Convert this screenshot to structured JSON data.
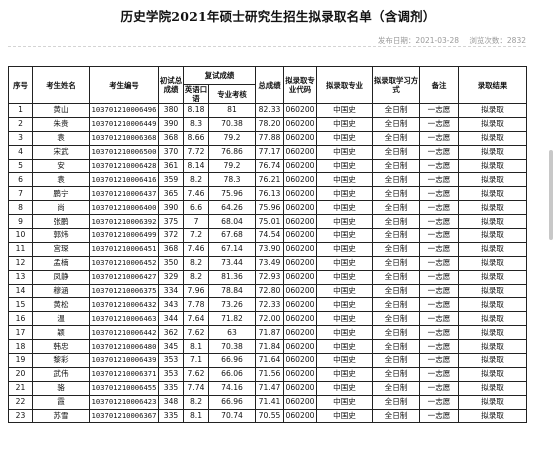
{
  "document": {
    "title": "历史学院2021年硕士研究生招生拟录取名单（含调剂）",
    "publish_label": "发布日期：2021-03-28",
    "views_label": "浏览次数：2832"
  },
  "table": {
    "headers": {
      "seq": "序号",
      "name": "考生姓名",
      "exam_no": "考生编号",
      "initial_score": "初试总成绩",
      "retest_group": "复试成绩",
      "english_oral": "英语口语",
      "major_exam": "专业考核",
      "total": "总成绩",
      "major_code": "拟录取专业代码",
      "major": "拟录取专业",
      "study_mode": "拟录取学习方式",
      "remark": "备注",
      "result": "录取结果"
    },
    "rows": [
      {
        "seq": "1",
        "name": "黄山",
        "exam_no": "103701210006496",
        "initial": "380",
        "english": "8.18",
        "major_exam": "81",
        "total": "82.33",
        "code": "060200",
        "major": "中国史",
        "mode": "全日制",
        "remark": "一志愿",
        "result": "拟录取"
      },
      {
        "seq": "2",
        "name": "朱贵",
        "exam_no": "103701210006449",
        "initial": "390",
        "english": "8.3",
        "major_exam": "70.38",
        "total": "78.20",
        "code": "060200",
        "major": "中国史",
        "mode": "全日制",
        "remark": "一志愿",
        "result": "拟录取"
      },
      {
        "seq": "3",
        "name": "袁",
        "exam_no": "103701210006368",
        "initial": "368",
        "english": "8.66",
        "major_exam": "79.2",
        "total": "77.88",
        "code": "060200",
        "major": "中国史",
        "mode": "全日制",
        "remark": "一志愿",
        "result": "拟录取"
      },
      {
        "seq": "4",
        "name": "宋武",
        "exam_no": "103701210006500",
        "initial": "370",
        "english": "7.72",
        "major_exam": "76.86",
        "total": "77.17",
        "code": "060200",
        "major": "中国史",
        "mode": "全日制",
        "remark": "一志愿",
        "result": "拟录取"
      },
      {
        "seq": "5",
        "name": "安",
        "exam_no": "103701210006428",
        "initial": "361",
        "english": "8.14",
        "major_exam": "79.2",
        "total": "76.74",
        "code": "060200",
        "major": "中国史",
        "mode": "全日制",
        "remark": "一志愿",
        "result": "拟录取"
      },
      {
        "seq": "6",
        "name": "袁",
        "exam_no": "103701210006416",
        "initial": "359",
        "english": "8.2",
        "major_exam": "78.3",
        "total": "76.21",
        "code": "060200",
        "major": "中国史",
        "mode": "全日制",
        "remark": "一志愿",
        "result": "拟录取"
      },
      {
        "seq": "7",
        "name": "鹏宁",
        "exam_no": "103701210006437",
        "initial": "365",
        "english": "7.46",
        "major_exam": "75.96",
        "total": "76.13",
        "code": "060200",
        "major": "中国史",
        "mode": "全日制",
        "remark": "一志愿",
        "result": "拟录取"
      },
      {
        "seq": "8",
        "name": "尚",
        "exam_no": "103701210006400",
        "initial": "390",
        "english": "6.6",
        "major_exam": "64.26",
        "total": "75.96",
        "code": "060200",
        "major": "中国史",
        "mode": "全日制",
        "remark": "一志愿",
        "result": "拟录取"
      },
      {
        "seq": "9",
        "name": "张鹏",
        "exam_no": "103701210006392",
        "initial": "375",
        "english": "7",
        "major_exam": "68.04",
        "total": "75.01",
        "code": "060200",
        "major": "中国史",
        "mode": "全日制",
        "remark": "一志愿",
        "result": "拟录取"
      },
      {
        "seq": "10",
        "name": "郭炜",
        "exam_no": "103701210006499",
        "initial": "372",
        "english": "7.2",
        "major_exam": "67.68",
        "total": "74.54",
        "code": "060200",
        "major": "中国史",
        "mode": "全日制",
        "remark": "一志愿",
        "result": "拟录取"
      },
      {
        "seq": "11",
        "name": "宫琛",
        "exam_no": "103701210006451",
        "initial": "368",
        "english": "7.46",
        "major_exam": "67.14",
        "total": "73.90",
        "code": "060200",
        "major": "中国史",
        "mode": "全日制",
        "remark": "一志愿",
        "result": "拟录取"
      },
      {
        "seq": "12",
        "name": "孟楠",
        "exam_no": "103701210006452",
        "initial": "350",
        "english": "8.2",
        "major_exam": "73.44",
        "total": "73.49",
        "code": "060200",
        "major": "中国史",
        "mode": "全日制",
        "remark": "一志愿",
        "result": "拟录取"
      },
      {
        "seq": "13",
        "name": "凤静",
        "exam_no": "103701210006427",
        "initial": "329",
        "english": "8.2",
        "major_exam": "81.36",
        "total": "72.93",
        "code": "060200",
        "major": "中国史",
        "mode": "全日制",
        "remark": "一志愿",
        "result": "拟录取"
      },
      {
        "seq": "14",
        "name": "穆涵",
        "exam_no": "103701210006375",
        "initial": "334",
        "english": "7.96",
        "major_exam": "78.84",
        "total": "72.80",
        "code": "060200",
        "major": "中国史",
        "mode": "全日制",
        "remark": "一志愿",
        "result": "拟录取"
      },
      {
        "seq": "15",
        "name": "黄松",
        "exam_no": "103701210006432",
        "initial": "343",
        "english": "7.78",
        "major_exam": "73.26",
        "total": "72.33",
        "code": "060200",
        "major": "中国史",
        "mode": "全日制",
        "remark": "一志愿",
        "result": "拟录取"
      },
      {
        "seq": "16",
        "name": "温",
        "exam_no": "103701210006463",
        "initial": "344",
        "english": "7.64",
        "major_exam": "71.82",
        "total": "72.00",
        "code": "060200",
        "major": "中国史",
        "mode": "全日制",
        "remark": "一志愿",
        "result": "拟录取"
      },
      {
        "seq": "17",
        "name": "颖",
        "exam_no": "103701210006442",
        "initial": "362",
        "english": "7.62",
        "major_exam": "63",
        "total": "71.87",
        "code": "060200",
        "major": "中国史",
        "mode": "全日制",
        "remark": "一志愿",
        "result": "拟录取"
      },
      {
        "seq": "18",
        "name": "韩忠",
        "exam_no": "103701210006480",
        "initial": "345",
        "english": "8.1",
        "major_exam": "70.38",
        "total": "71.84",
        "code": "060200",
        "major": "中国史",
        "mode": "全日制",
        "remark": "一志愿",
        "result": "拟录取"
      },
      {
        "seq": "19",
        "name": "黎彩",
        "exam_no": "103701210006439",
        "initial": "353",
        "english": "7.1",
        "major_exam": "66.96",
        "total": "71.64",
        "code": "060200",
        "major": "中国史",
        "mode": "全日制",
        "remark": "一志愿",
        "result": "拟录取"
      },
      {
        "seq": "20",
        "name": "武伟",
        "exam_no": "103701210006371",
        "initial": "353",
        "english": "7.62",
        "major_exam": "66.06",
        "total": "71.56",
        "code": "060200",
        "major": "中国史",
        "mode": "全日制",
        "remark": "一志愿",
        "result": "拟录取"
      },
      {
        "seq": "21",
        "name": "骆",
        "exam_no": "103701210006455",
        "initial": "335",
        "english": "7.74",
        "major_exam": "74.16",
        "total": "71.47",
        "code": "060200",
        "major": "中国史",
        "mode": "全日制",
        "remark": "一志愿",
        "result": "拟录取"
      },
      {
        "seq": "22",
        "name": "霞",
        "exam_no": "103701210006423",
        "initial": "348",
        "english": "8.2",
        "major_exam": "66.96",
        "total": "71.41",
        "code": "060200",
        "major": "中国史",
        "mode": "全日制",
        "remark": "一志愿",
        "result": "拟录取"
      },
      {
        "seq": "23",
        "name": "苏雪",
        "exam_no": "103701210006367",
        "initial": "335",
        "english": "8.1",
        "major_exam": "70.74",
        "total": "70.55",
        "code": "060200",
        "major": "中国史",
        "mode": "全日制",
        "remark": "一志愿",
        "result": "拟录取"
      }
    ]
  }
}
